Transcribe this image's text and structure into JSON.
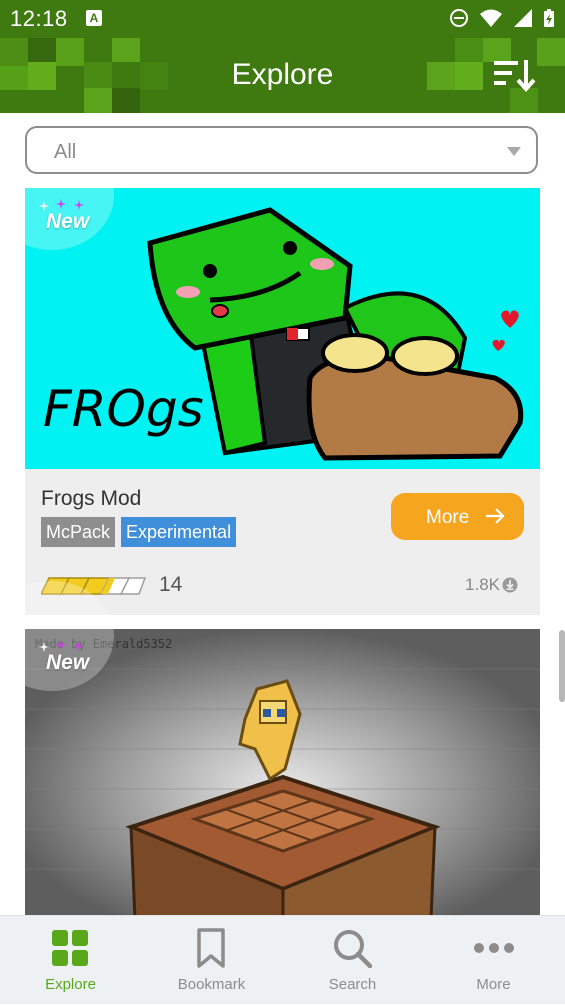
{
  "status_bar": {
    "time": "12:18",
    "notification_badge": "A"
  },
  "header": {
    "title": "Explore",
    "sort_icon": "sort-icon"
  },
  "filter": {
    "selected": "All"
  },
  "cards": [
    {
      "badge": "New",
      "image_text": "FROgs",
      "title": "Frogs Mod",
      "tags": [
        "McPack",
        "Experimental"
      ],
      "more_label": "More",
      "rating": 3.5,
      "rating_count": "14",
      "downloads": "1.8K"
    },
    {
      "badge": "New",
      "watermark": "Made by Emerald5352"
    }
  ],
  "bottom_nav": [
    {
      "label": "Explore",
      "icon": "grid-icon",
      "active": true
    },
    {
      "label": "Bookmark",
      "icon": "bookmark-icon",
      "active": false
    },
    {
      "label": "Search",
      "icon": "search-icon",
      "active": false
    },
    {
      "label": "More",
      "icon": "more-dots-icon",
      "active": false
    }
  ],
  "colors": {
    "header": "#3f7a10",
    "accent_orange": "#f6a51f",
    "tag_blue": "#3f8fdb",
    "tag_gray": "#8e8e8e",
    "active_nav": "#58a81a",
    "image_background": "#00f2f2"
  }
}
